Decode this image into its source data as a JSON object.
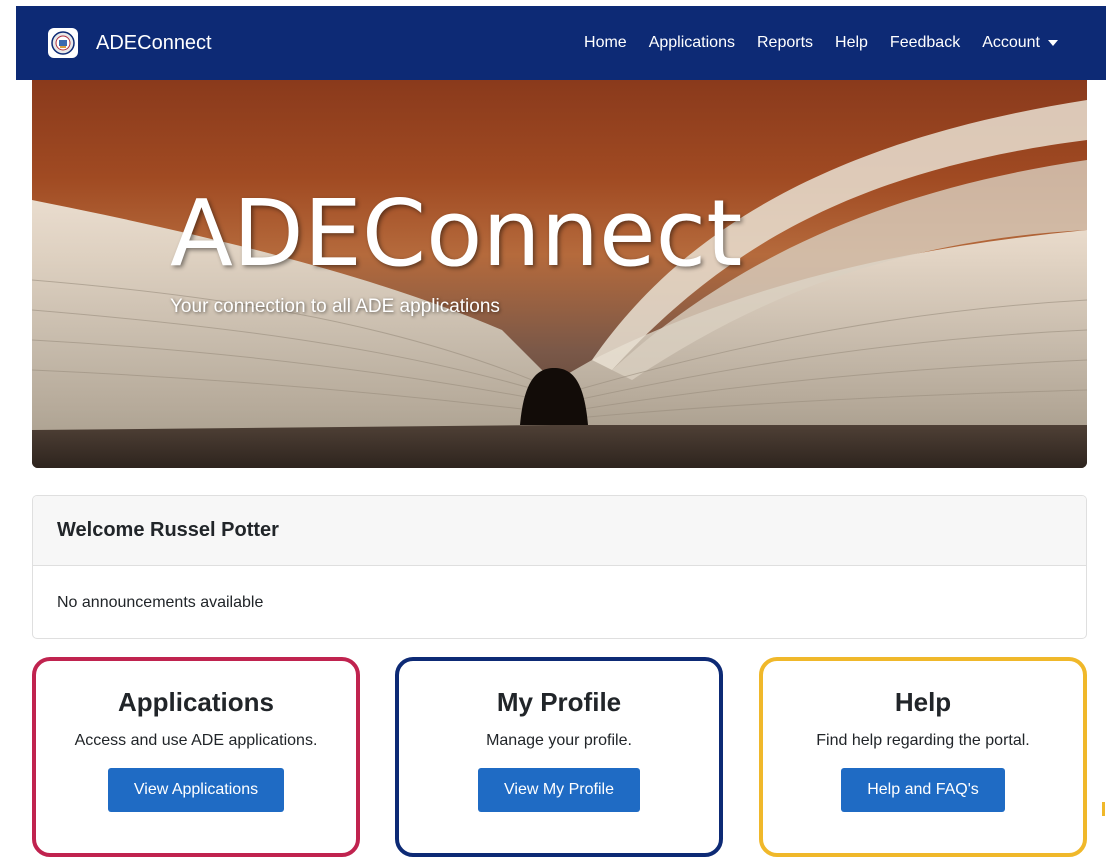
{
  "nav": {
    "brand": "ADEConnect",
    "links": [
      "Home",
      "Applications",
      "Reports",
      "Help",
      "Feedback",
      "Account"
    ]
  },
  "hero": {
    "title": "ADEConnect",
    "subtitle": "Your connection to all ADE applications"
  },
  "welcome": {
    "title": "Welcome Russel Potter",
    "body": "No announcements available"
  },
  "tiles": [
    {
      "title": "Applications",
      "description": "Access and use ADE applications.",
      "button": "View Applications",
      "color": "#c0234f"
    },
    {
      "title": "My Profile",
      "description": "Manage your profile.",
      "button": "View My Profile",
      "color": "#0d2a75"
    },
    {
      "title": "Help",
      "description": "Find help regarding the portal.",
      "button": "Help and FAQ's",
      "color": "#f0b82a"
    }
  ],
  "colors": {
    "navbar": "#0d2a75",
    "button": "#1f6bc4"
  }
}
